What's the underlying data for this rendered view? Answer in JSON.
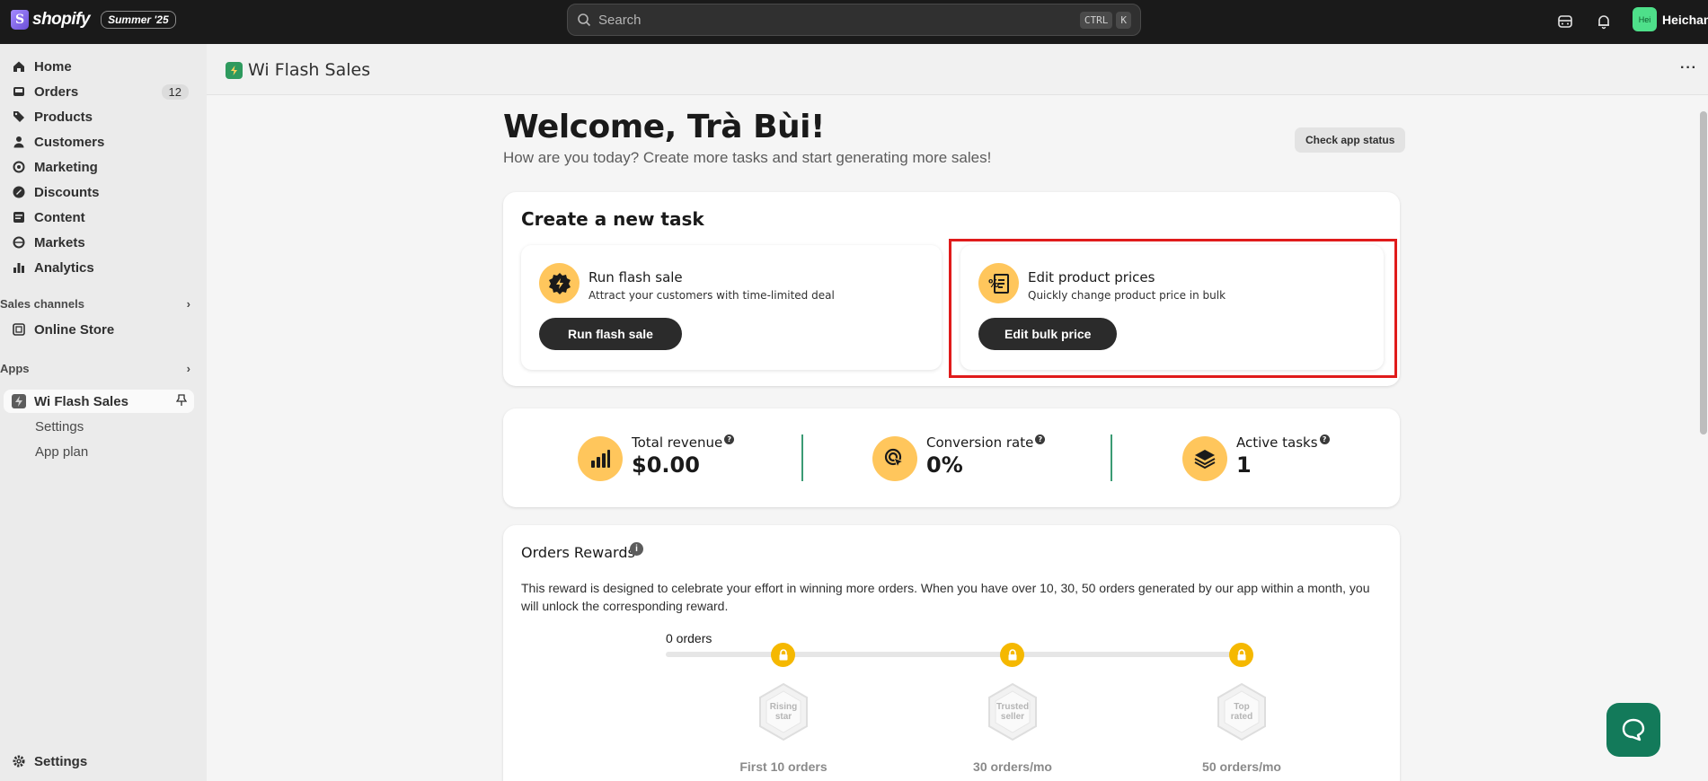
{
  "topbar": {
    "brand": "shopify",
    "edition": "Summer '25",
    "search_placeholder": "Search",
    "shortcut_ctrl": "CTRL",
    "shortcut_k": "K",
    "user_initials": "Hei",
    "user_name": "Heichan"
  },
  "sidebar": {
    "items": [
      {
        "label": "Home",
        "icon": "home-icon"
      },
      {
        "label": "Orders",
        "icon": "inbox-icon",
        "badge": "12"
      },
      {
        "label": "Products",
        "icon": "tag-icon"
      },
      {
        "label": "Customers",
        "icon": "person-icon"
      },
      {
        "label": "Marketing",
        "icon": "target-icon"
      },
      {
        "label": "Discounts",
        "icon": "discount-icon"
      },
      {
        "label": "Content",
        "icon": "content-icon"
      },
      {
        "label": "Markets",
        "icon": "globe-icon"
      },
      {
        "label": "Analytics",
        "icon": "chart-icon"
      }
    ],
    "sales_channels_label": "Sales channels",
    "online_store": "Online Store",
    "apps_label": "Apps",
    "app_name": "Wi Flash Sales",
    "app_sub_settings": "Settings",
    "app_sub_plan": "App plan",
    "settings": "Settings"
  },
  "header": {
    "title": "Wi Flash Sales",
    "more": "···"
  },
  "welcome": {
    "title": "Welcome, Trà Bùi!",
    "subtitle": "How are you today? Create more tasks and start generating more sales!",
    "status_button": "Check app status"
  },
  "create_task": {
    "title": "Create a new task",
    "tasks": [
      {
        "title": "Run flash sale",
        "desc": "Attract your customers with time-limited deal",
        "button": "Run flash sale"
      },
      {
        "title": "Edit product prices",
        "desc": "Quickly change product price in bulk",
        "button": "Edit bulk price"
      }
    ]
  },
  "stats": [
    {
      "label": "Total revenue",
      "value": "$0.00",
      "icon": "bar-chart-icon"
    },
    {
      "label": "Conversion rate",
      "value": "0%",
      "icon": "cursor-target-icon"
    },
    {
      "label": "Active tasks",
      "value": "1",
      "icon": "layers-icon"
    }
  ],
  "rewards": {
    "title": "Orders Rewards",
    "description": "This reward is designed to celebrate your effort in winning more orders. When you have over 10, 30, 50 orders generated by our app within a month, you will unlock the corresponding reward.",
    "orders_count": "0 orders",
    "progress": 0,
    "tiers": [
      {
        "badge_line1": "Rising",
        "badge_line2": "star",
        "label": "First 10 orders"
      },
      {
        "badge_line1": "Trusted",
        "badge_line2": "seller",
        "label": "30 orders/mo"
      },
      {
        "badge_line1": "Top",
        "badge_line2": "rated",
        "label": "50 orders/mo"
      }
    ]
  },
  "colors": {
    "accent_yellow": "#ffc65c",
    "dark_button": "#2b2b2b",
    "highlight_red": "#e01b1b",
    "chat_green": "#137a5a"
  }
}
